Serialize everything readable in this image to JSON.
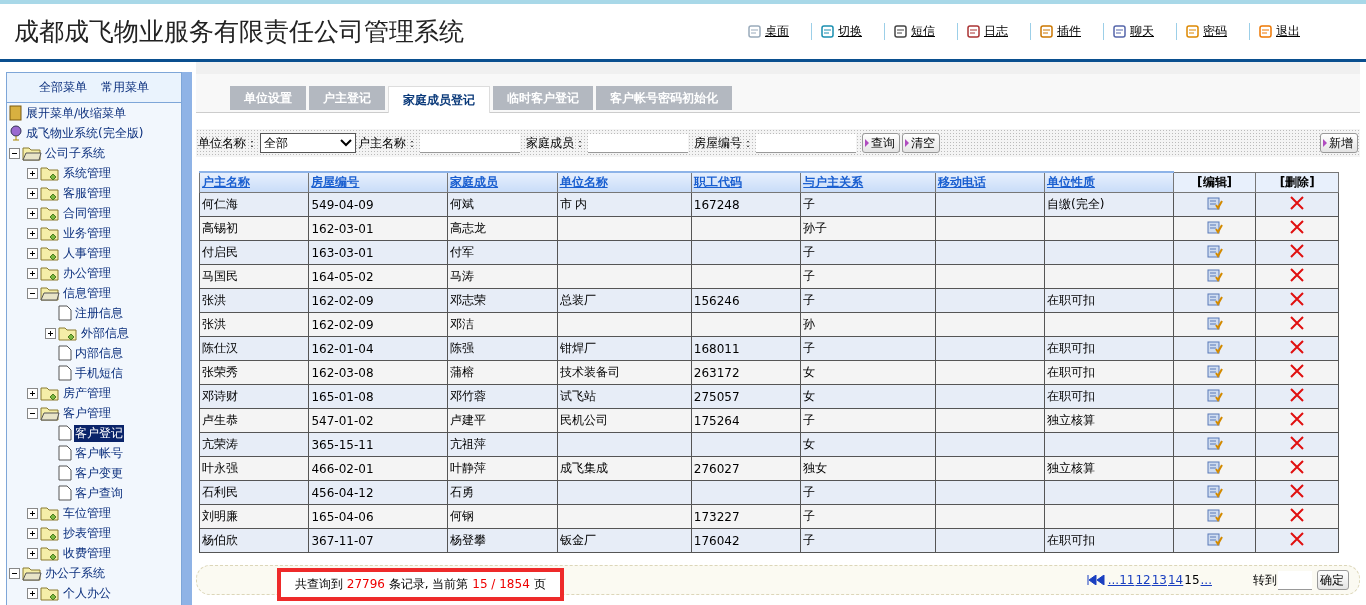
{
  "header": {
    "title": "成都成飞物业服务有限责任公司管理系统",
    "nav": [
      {
        "label": "桌面",
        "kind": "desktop"
      },
      {
        "label": "切换",
        "kind": "switch"
      },
      {
        "label": "短信",
        "kind": "message"
      },
      {
        "label": "日志",
        "kind": "log"
      },
      {
        "label": "插件",
        "kind": "plugin"
      },
      {
        "label": "聊天",
        "kind": "chat"
      },
      {
        "label": "密码",
        "kind": "password"
      },
      {
        "label": "退出",
        "kind": "exit"
      }
    ]
  },
  "sidebar": {
    "menu_tabs": [
      "全部菜单",
      "常用菜单"
    ],
    "toggle": "展开菜单/收缩菜单",
    "root": "成飞物业系统(完全版)",
    "tree": [
      {
        "label": "公司子系统",
        "kind": "folder",
        "expanded": true,
        "selected": false,
        "children": [
          {
            "label": "系统管理",
            "kind": "folder",
            "expanded": false,
            "selected": false
          },
          {
            "label": "客服管理",
            "kind": "folder",
            "expanded": false,
            "selected": false
          },
          {
            "label": "合同管理",
            "kind": "folder",
            "expanded": false,
            "selected": false
          },
          {
            "label": "业务管理",
            "kind": "folder",
            "expanded": false,
            "selected": false
          },
          {
            "label": "人事管理",
            "kind": "folder",
            "expanded": false,
            "selected": false
          },
          {
            "label": "办公管理",
            "kind": "folder",
            "expanded": false,
            "selected": false
          },
          {
            "label": "信息管理",
            "kind": "folder",
            "expanded": true,
            "selected": false,
            "children": [
              {
                "label": "注册信息",
                "kind": "page",
                "selected": false
              },
              {
                "label": "外部信息",
                "kind": "folder",
                "expanded": false,
                "selected": false
              },
              {
                "label": "内部信息",
                "kind": "page",
                "selected": false
              },
              {
                "label": "手机短信",
                "kind": "page",
                "selected": false
              }
            ]
          },
          {
            "label": "房产管理",
            "kind": "folder",
            "expanded": false,
            "selected": false
          },
          {
            "label": "客户管理",
            "kind": "folder",
            "expanded": true,
            "selected": false,
            "children": [
              {
                "label": "客户登记",
                "kind": "page",
                "selected": true
              },
              {
                "label": "客户帐号",
                "kind": "page",
                "selected": false
              },
              {
                "label": "客户变更",
                "kind": "page",
                "selected": false
              },
              {
                "label": "客户查询",
                "kind": "page",
                "selected": false
              }
            ]
          },
          {
            "label": "车位管理",
            "kind": "folder",
            "expanded": false,
            "selected": false
          },
          {
            "label": "抄表管理",
            "kind": "folder",
            "expanded": false,
            "selected": false
          },
          {
            "label": "收费管理",
            "kind": "folder",
            "expanded": false,
            "selected": false
          }
        ]
      },
      {
        "label": "办公子系统",
        "kind": "folder",
        "expanded": true,
        "selected": false,
        "children": [
          {
            "label": "个人办公",
            "kind": "folder",
            "expanded": false,
            "selected": false
          }
        ]
      }
    ]
  },
  "tabs": [
    {
      "label": "单位设置",
      "selected": false
    },
    {
      "label": "户主登记",
      "selected": false
    },
    {
      "label": "家庭成员登记",
      "selected": true
    },
    {
      "label": "临时客户登记",
      "selected": false
    },
    {
      "label": "客户帐号密码初始化",
      "selected": false
    }
  ],
  "filters": {
    "unit_label": "单位名称：",
    "unit_value": "全部",
    "owner_label": "户主名称：",
    "member_label": "家庭成员：",
    "house_label": "房屋编号：",
    "query": "查询",
    "clear": "清空",
    "add": "新增"
  },
  "table": {
    "columns": [
      "户主名称",
      "房屋编号",
      "家庭成员",
      "单位名称",
      "职工代码",
      "与户主关系",
      "移动电话",
      "单位性质"
    ],
    "edit_header": "[编辑]",
    "delete_header": "[删除]",
    "rows": [
      [
        "何仁海",
        "549-04-09",
        "何斌",
        "市 内",
        "167248",
        "子",
        "",
        "自缴(完全)"
      ],
      [
        "高锡初",
        "162-03-01",
        "高志龙",
        "",
        "",
        "孙子",
        "",
        ""
      ],
      [
        "付启民",
        "163-03-01",
        "付军",
        "",
        "",
        "子",
        "",
        ""
      ],
      [
        "马国民",
        "164-05-02",
        "马涛",
        "",
        "",
        "子",
        "",
        ""
      ],
      [
        "张洪",
        "162-02-09",
        "邓志荣",
        "总装厂",
        "156246",
        "子",
        "",
        "在职可扣"
      ],
      [
        "张洪",
        "162-02-09",
        "邓洁",
        "",
        "",
        "孙",
        "",
        ""
      ],
      [
        "陈仕汉",
        "162-01-04",
        "陈强",
        "钳焊厂",
        "168011",
        "子",
        "",
        "在职可扣"
      ],
      [
        "张荣秀",
        "162-03-08",
        "蒲榕",
        "技术装备司",
        "263172",
        "女",
        "",
        "在职可扣"
      ],
      [
        "邓诗财",
        "165-01-08",
        "邓竹蓉",
        "试飞站",
        "275057",
        "女",
        "",
        "在职可扣"
      ],
      [
        "卢生恭",
        "547-01-02",
        "卢建平",
        "民机公司",
        "175264",
        "子",
        "",
        "独立核算"
      ],
      [
        "亢荣涛",
        "365-15-11",
        "亢祖萍",
        "",
        "",
        "女",
        "",
        ""
      ],
      [
        "叶永强",
        "466-02-01",
        "叶静萍",
        "成飞集成",
        "276027",
        "独女",
        "",
        "独立核算"
      ],
      [
        "石利民",
        "456-04-12",
        "石勇",
        "",
        "",
        "子",
        "",
        ""
      ],
      [
        "刘明廉",
        "165-04-06",
        "何钢",
        "",
        "173227",
        "子",
        "",
        ""
      ],
      [
        "杨伯欣",
        "367-11-07",
        "杨登攀",
        "钣金厂",
        "176042",
        "子",
        "",
        "在职可扣"
      ]
    ]
  },
  "footer": {
    "summary": "共查询到 **27796** 条记录, 当前第 **15 / 1854** 页",
    "pages": [
      {
        "label": "...11",
        "selected": false
      },
      {
        "label": "12",
        "selected": false
      },
      {
        "label": "13",
        "selected": false
      },
      {
        "label": "14",
        "selected": false
      },
      {
        "label": "15",
        "selected": true
      },
      {
        "label": "...",
        "selected": false
      }
    ],
    "goto": "转到",
    "go": "确定"
  }
}
